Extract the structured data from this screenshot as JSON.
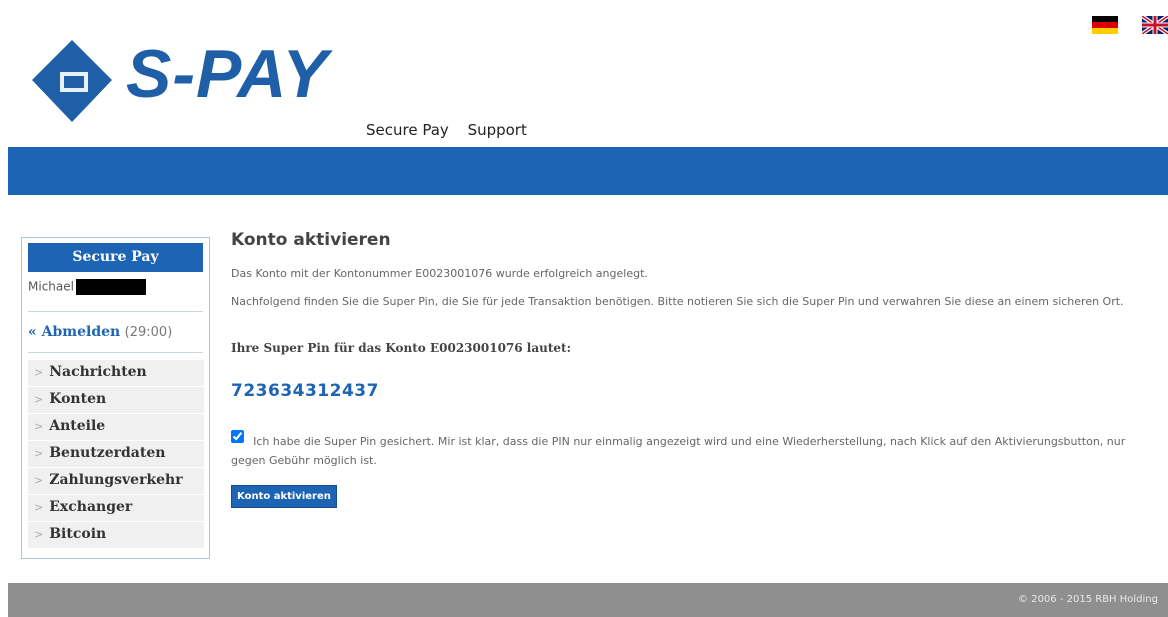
{
  "header": {
    "logo_text": "S-PAY",
    "nav": [
      "Secure Pay",
      "Support"
    ],
    "languages": [
      "de-flag-icon",
      "uk-flag-icon"
    ]
  },
  "sidebar": {
    "title": "Secure Pay",
    "user": "Michael",
    "logout_label": "« Abmelden",
    "session_time": "(29:00)",
    "items": [
      "Nachrichten",
      "Konten",
      "Anteile",
      "Benutzerdaten",
      "Zahlungsverkehr",
      "Exchanger",
      "Bitcoin"
    ]
  },
  "main": {
    "title": "Konto aktivieren",
    "message": "Das Konto mit der Kontonummer E0023001076 wurde erfolgreich angelegt.",
    "instruction": "Nachfolgend finden Sie die Super Pin, die Sie für jede Transaktion benötigen. Bitte notieren Sie sich die Super Pin und verwahren Sie diese an einem sicheren Ort.",
    "pin_label": "Ihre Super Pin für das Konto E0023001076 lautet:",
    "pin": "723634312437",
    "checkbox_text": "Ich habe die Super Pin gesichert. Mir ist klar, dass die PIN nur einmalig angezeigt wird und eine Wiederherstellung, nach Klick auf den Aktivierungsbutton, nur gegen Gebühr möglich ist.",
    "checkbox_checked": true,
    "button_label": "Konto aktivieren"
  },
  "footer": {
    "copyright": "© 2006 - 2015 RBH Holding"
  },
  "colors": {
    "brand": "#1e64b4",
    "footer": "#8f8f8f"
  }
}
